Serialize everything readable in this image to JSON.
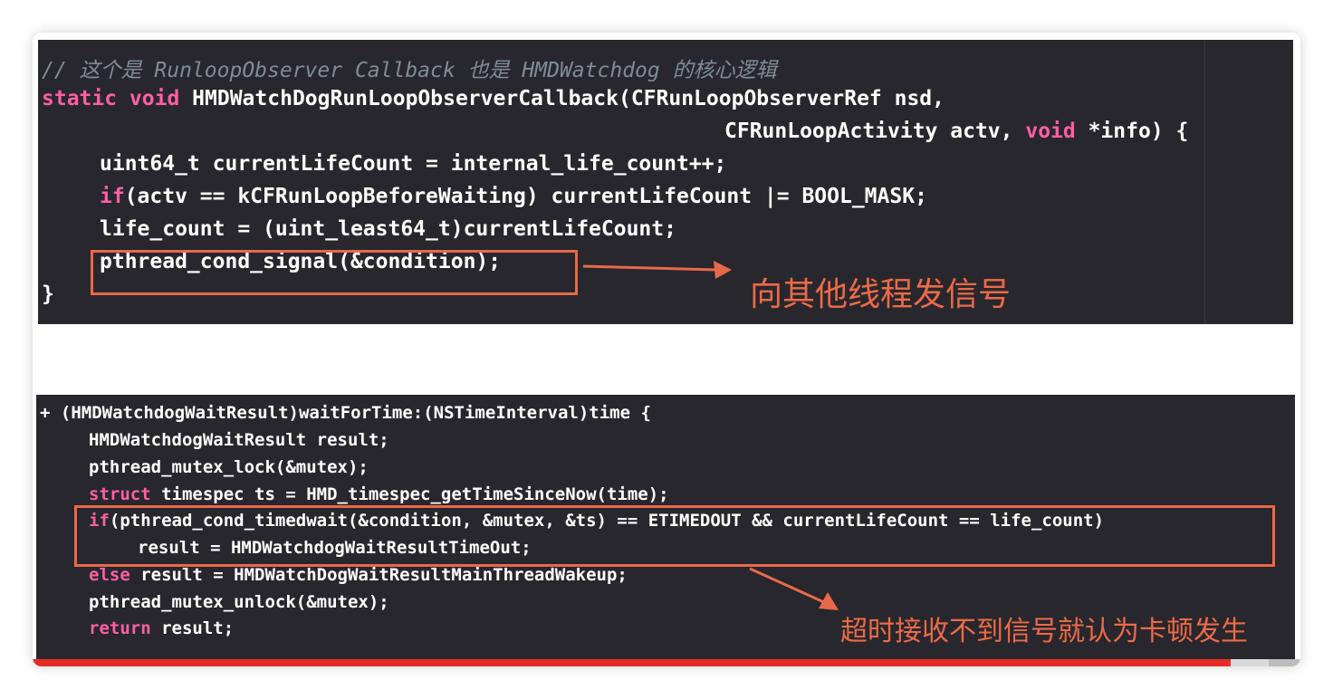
{
  "top_code": {
    "comment": "// 这个是 RunloopObserver Callback 也是 HMDWatchdog 的核心逻辑",
    "line1_kw": "static void ",
    "line1_rest": "HMDWatchDogRunLoopObserverCallback(CFRunLoopObserverRef nsd,",
    "line2_a": "CFRunLoopActivity actv, ",
    "line2_kw": "void",
    "line2_b": " *info) {",
    "line3": "uint64_t currentLifeCount = internal_life_count++;",
    "line4_kw": "if",
    "line4_rest": "(actv == kCFRunLoopBeforeWaiting) currentLifeCount |= BOOL_MASK;",
    "line5": "life_count = (uint_least64_t)currentLifeCount;",
    "line6": "pthread_cond_signal(&condition);",
    "line7": "}",
    "annotation": "向其他线程发信号"
  },
  "bottom_code": {
    "line1": "+ (HMDWatchdogWaitResult)waitForTime:(NSTimeInterval)time {",
    "line2": "HMDWatchdogWaitResult result;",
    "line3": "pthread_mutex_lock(&mutex);",
    "line4_kw": "struct",
    "line4_rest": " timespec ts = HMD_timespec_getTimeSinceNow(time);",
    "line5_kw": "if",
    "line5_rest": "(pthread_cond_timedwait(&condition, &mutex, &ts) == ETIMEDOUT && currentLifeCount == life_count)",
    "line6": "result = HMDWatchdogWaitResultTimeOut;",
    "line7_kw": "else",
    "line7_rest": " result = HMDWatchDogWaitResultMainThreadWakeup;",
    "line8": "pthread_mutex_unlock(&mutex);",
    "line9_kw": "return",
    "line9_rest": " result;",
    "annotation": "超时接收不到信号就认为卡顿发生"
  },
  "video_progress": {
    "played_fraction": 0.945,
    "buffered_fraction": 0.975
  },
  "colors": {
    "editor_bg": "#28272d",
    "keyword": "#fc5fa3",
    "comment": "#7f8c98",
    "annotation": "#ec6a47",
    "progress_played": "#e52d27"
  }
}
